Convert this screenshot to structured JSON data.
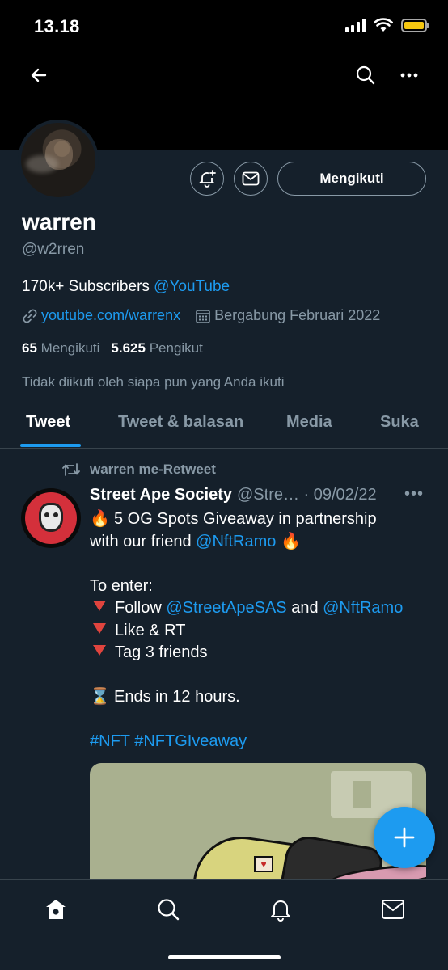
{
  "status_bar": {
    "time": "13.18"
  },
  "header": {
    "back_icon": "arrow-left-icon",
    "search_icon": "search-icon",
    "more_icon": "more-horizontal-icon"
  },
  "profile": {
    "name": "warren",
    "handle": "@w2rren",
    "bio_text": "170k+ Subscribers ",
    "bio_link": "@YouTube",
    "website": "youtube.com/warrenx",
    "joined": "Bergabung Februari 2022",
    "following_count": "65",
    "following_label": "Mengikuti",
    "followers_count": "5.625",
    "followers_label": "Pengikut",
    "not_followed_text": "Tidak diikuti oleh siapa pun yang Anda ikuti",
    "follow_button_label": "Mengikuti"
  },
  "tabs": [
    {
      "label": "Tweet",
      "active": true
    },
    {
      "label": "Tweet & balasan",
      "active": false
    },
    {
      "label": "Media",
      "active": false
    },
    {
      "label": "Suka",
      "active": false
    }
  ],
  "tweet": {
    "retweet_text": "warren me-Retweet",
    "author_name": "Street Ape Society",
    "author_handle": "@Stre… · 09/02/22",
    "more": "•••",
    "line1_text": "5 OG Spots Giveaway in partnership",
    "line2_text": "with our friend ",
    "line2_link": "@NftRamo",
    "to_enter": "To enter:",
    "follow_text": "Follow ",
    "follow_link1": "@StreetApeSAS",
    "follow_and": " and ",
    "follow_link2": "@NftRamo",
    "like_rt": "Like & RT",
    "tag_friends": "Tag 3 friends",
    "ends": "Ends in 12 hours.",
    "hashtags": "#NFT #NFTGIveaway",
    "emoji_fire": "🔥",
    "emoji_hourglass": "⌛"
  },
  "colors": {
    "background": "#15202b",
    "accent": "#1d9bf0",
    "secondary_text": "#8899a6",
    "border": "#38444d"
  },
  "bottom_nav": [
    "home-icon",
    "search-icon",
    "notifications-icon",
    "messages-icon"
  ]
}
